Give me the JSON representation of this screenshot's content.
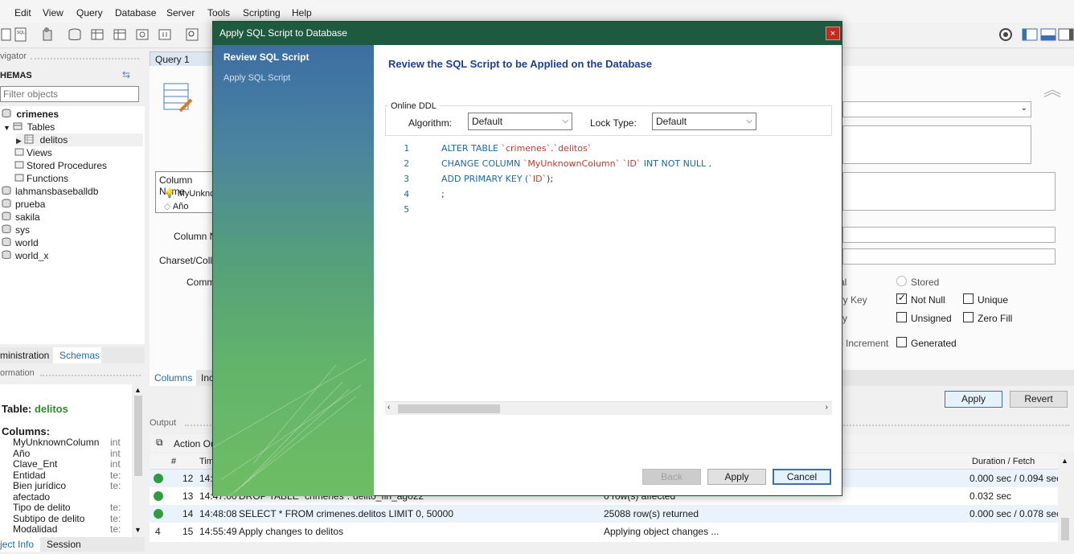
{
  "menu": [
    "Edit",
    "View",
    "Query",
    "Database",
    "Server",
    "Tools",
    "Scripting",
    "Help"
  ],
  "navigator": {
    "header": "vigator",
    "schemas_title": "HEMAS",
    "filter_placeholder": "Filter objects",
    "tree": [
      {
        "label": "crimenes",
        "kind": "schema",
        "bold": true
      },
      {
        "label": "Tables",
        "kind": "folder"
      },
      {
        "label": "delitos",
        "kind": "table"
      },
      {
        "label": "Views",
        "kind": "folder"
      },
      {
        "label": "Stored Procedures",
        "kind": "folder"
      },
      {
        "label": "Functions",
        "kind": "folder"
      },
      {
        "label": "lahmansbaseballdb",
        "kind": "schema"
      },
      {
        "label": "prueba",
        "kind": "schema"
      },
      {
        "label": "sakila",
        "kind": "schema"
      },
      {
        "label": "sys",
        "kind": "schema"
      },
      {
        "label": "world",
        "kind": "schema"
      },
      {
        "label": "world_x",
        "kind": "schema"
      }
    ],
    "tabs": [
      "ministration",
      "Schemas"
    ]
  },
  "information": {
    "header": "ormation",
    "table_label": "Table:",
    "table_name": "delitos",
    "columns_label": "Columns:",
    "columns": [
      {
        "name": "MyUnknownColumn",
        "type": "int"
      },
      {
        "name": "Año",
        "type": "int"
      },
      {
        "name": "Clave_Ent",
        "type": "int"
      },
      {
        "name": "Entidad",
        "type": "te:"
      },
      {
        "name": "Bien jurídico",
        "type": "te:"
      },
      {
        "name": "afectado",
        "type": ""
      },
      {
        "name": "Tipo de delito",
        "type": "te:"
      },
      {
        "name": "Subtipo de delito",
        "type": "te:"
      },
      {
        "name": "Modalidad",
        "type": "te:"
      }
    ],
    "bottom_tabs": [
      "ject Info",
      "Session"
    ]
  },
  "editor": {
    "tab": "Query 1",
    "column_header": "Column Name",
    "columns": [
      "MyUnknc",
      "Año"
    ],
    "field_labels": [
      "Column Na",
      "Charset/Colla",
      "Comme"
    ],
    "bottom_tabs": [
      "Columns",
      "Inc"
    ],
    "right_labels": [
      "al",
      "ary Key",
      "ry",
      "o Increment"
    ],
    "checks": [
      {
        "label": "Stored",
        "type": "radio",
        "checked": false
      },
      {
        "label": "Not Null",
        "type": "check",
        "checked": true
      },
      {
        "label": "Unique",
        "type": "check",
        "checked": false
      },
      {
        "label": "Unsigned",
        "type": "check",
        "checked": false
      },
      {
        "label": "Zero Fill",
        "type": "check",
        "checked": false
      },
      {
        "label": "Generated",
        "type": "check",
        "checked": false
      }
    ],
    "apply": "Apply",
    "revert": "Revert"
  },
  "output": {
    "header": "Output",
    "selector": "Action Ou",
    "columns": [
      "#",
      "Tim",
      "Duration / Fetch"
    ],
    "rows": [
      {
        "status": "ok",
        "num": "12",
        "time": "14:4",
        "action": "",
        "message": "",
        "duration": "0.000 sec / 0.094 sec"
      },
      {
        "status": "ok",
        "num": "13",
        "time": "14:47:00",
        "action": "DROP TABLE `crimenes`.`delito_fin_ago22`",
        "message": "0 row(s) affected",
        "duration": "0.032 sec"
      },
      {
        "status": "ok",
        "num": "14",
        "time": "14:48:08",
        "action": "SELECT * FROM crimenes.delitos LIMIT 0, 50000",
        "message": "25088 row(s) returned",
        "duration": "0.000 sec / 0.078 sec"
      },
      {
        "status": "4",
        "num": "15",
        "time": "14:55:49",
        "action": "Apply changes to delitos",
        "message": "Applying object changes ...",
        "duration": ""
      }
    ]
  },
  "dialog": {
    "title": "Apply SQL Script to Database",
    "close": "×",
    "steps": [
      "Review SQL Script",
      "Apply SQL Script"
    ],
    "heading": "Review the SQL Script to be Applied on the Database",
    "online_ddl": "Online DDL",
    "algorithm_label": "Algorithm:",
    "algorithm_value": "Default",
    "lock_label": "Lock Type:",
    "lock_value": "Default",
    "line_numbers": [
      "1",
      "2",
      "3",
      "4",
      "5"
    ],
    "buttons": {
      "back": "Back",
      "apply": "Apply",
      "cancel": "Cancel"
    }
  },
  "colors": {
    "dialog_title_bg": "#1e5a3f",
    "heading": "#1f3f8f",
    "sql_keyword": "#1b6aa5",
    "sql_identifier": "#c0392b",
    "ok": "#2e9c3f",
    "close_red": "#c42b1c"
  }
}
